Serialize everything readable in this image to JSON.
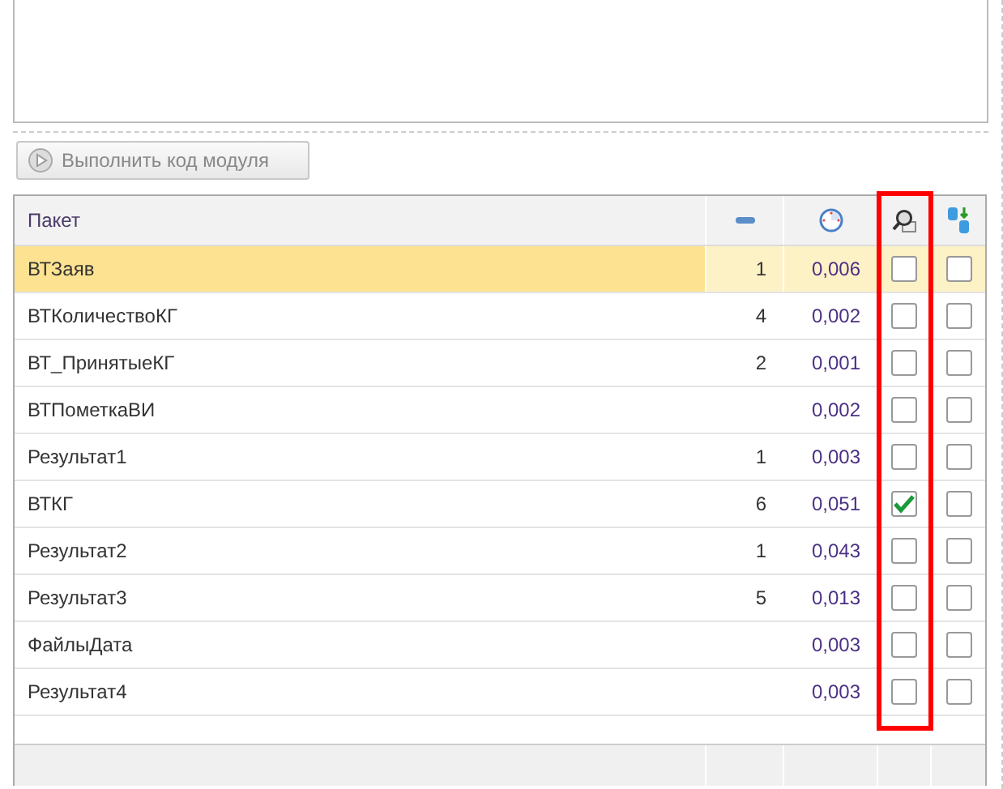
{
  "run_button": {
    "label": "Выполнить код модуля"
  },
  "table": {
    "columns": [
      {
        "kind": "text",
        "label": "Пакет"
      },
      {
        "kind": "count-icon"
      },
      {
        "kind": "time-icon"
      },
      {
        "kind": "inspect-icon",
        "highlighted": true
      },
      {
        "kind": "export-icon",
        "highlighted": false
      }
    ],
    "rows": [
      {
        "name": "ВТЗаяв",
        "count": "1",
        "time": "0,006",
        "inspect": false,
        "export": false,
        "selected": true
      },
      {
        "name": "ВТКоличествоКГ",
        "count": "4",
        "time": "0,002",
        "inspect": false,
        "export": false,
        "selected": false
      },
      {
        "name": "ВТ_ПринятыеКГ",
        "count": "2",
        "time": "0,001",
        "inspect": false,
        "export": false,
        "selected": false
      },
      {
        "name": "ВТПометкаВИ",
        "time": "0,002",
        "inspect": false,
        "export": false,
        "selected": false
      },
      {
        "name": "Результат1",
        "count": "1",
        "time": "0,003",
        "inspect": false,
        "export": false,
        "selected": false
      },
      {
        "name": "ВТКГ",
        "count": "6",
        "time": "0,051",
        "inspect": true,
        "export": false,
        "selected": false
      },
      {
        "name": "Результат2",
        "count": "1",
        "time": "0,043",
        "inspect": false,
        "export": false,
        "selected": false
      },
      {
        "name": "Результат3",
        "count": "5",
        "time": "0,013",
        "inspect": false,
        "export": false,
        "selected": false
      },
      {
        "name": "ФайлыДата",
        "time": "0,003",
        "inspect": false,
        "export": false,
        "selected": false
      },
      {
        "name": "Результат4",
        "time": "0,003",
        "inspect": false,
        "export": false,
        "selected": false
      }
    ]
  }
}
